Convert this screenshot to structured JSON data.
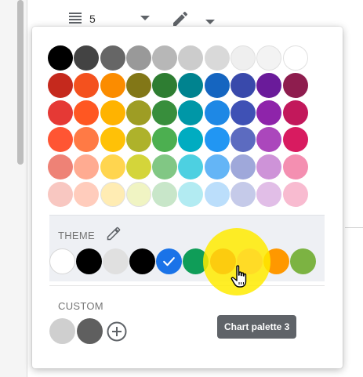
{
  "toolbar": {
    "line_count": "5"
  },
  "palette": {
    "rows": [
      [
        "#000000",
        "#434343",
        "#666666",
        "#999999",
        "#b7b7b7",
        "#cccccc",
        "#d9d9d9",
        "#efefef",
        "#f3f3f3",
        "#ffffff"
      ],
      [
        "#c5291d",
        "#f4511e",
        "#fb8c00",
        "#827717",
        "#2e7d32",
        "#00838f",
        "#1565c0",
        "#3949ab",
        "#6a1b9a",
        "#8e1d4e"
      ],
      [
        "#e53935",
        "#ff5722",
        "#ffb300",
        "#9e9d24",
        "#388e3c",
        "#0097a7",
        "#1e88e5",
        "#3f51b5",
        "#8e24aa",
        "#c2185b"
      ],
      [
        "#ff5533",
        "#ff7a45",
        "#ffc107",
        "#aeb22b",
        "#4caf50",
        "#00acc1",
        "#2196f3",
        "#5c6bc0",
        "#ab47bc",
        "#d81b60"
      ],
      [
        "#ee8276",
        "#ffab91",
        "#ffd54f",
        "#d4d53a",
        "#81c784",
        "#4dd0e1",
        "#64b5f6",
        "#9fa8da",
        "#ce93d8",
        "#f48fb1"
      ],
      [
        "#f8c7c1",
        "#ffccbc",
        "#ffecb3",
        "#f0f4c3",
        "#c8e6c9",
        "#b2ebf2",
        "#bbdefb",
        "#c5cae9",
        "#e1bee7",
        "#f8bbd0"
      ]
    ]
  },
  "theme": {
    "title": "THEME",
    "swatches": [
      "#ffffff",
      "#000000",
      "#e0e0e0",
      "#000000",
      "#1a73e8",
      "#0f9d58",
      "#e91e63",
      "#ff80ff",
      "#ff9800",
      "#7cb342"
    ],
    "selected_index": 4
  },
  "custom": {
    "title": "CUSTOM",
    "swatches": [
      "#cfcfcf",
      "#5f5f5f"
    ]
  },
  "tooltip": {
    "text": "Chart palette 3"
  }
}
